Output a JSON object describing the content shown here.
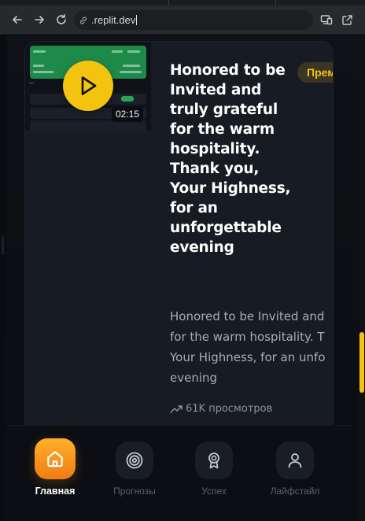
{
  "browser": {
    "url": ".replit.dev"
  },
  "card": {
    "duration": "02:15",
    "badge": "Прем",
    "title": "Honored to be Invited and truly grateful for the warm hospitality. Thank you, Your Highness, for an unforgettable evening",
    "description_lines": [
      "Honored to be Invited and",
      "for the warm hospitality. T",
      "Your Highness, for an unfo",
      "evening"
    ],
    "views": "61K просмотров"
  },
  "nav": {
    "items": [
      {
        "label": "Главная",
        "icon": "home-icon",
        "active": true
      },
      {
        "label": "Прогнозы",
        "icon": "target-icon",
        "active": false
      },
      {
        "label": "Успех",
        "icon": "award-icon",
        "active": false
      },
      {
        "label": "Лайфстайл",
        "icon": "user-icon",
        "active": false
      }
    ]
  },
  "colors": {
    "accent": "#f2c40f",
    "active_nav": "#f59a1c",
    "card_bg": "#161b24"
  }
}
